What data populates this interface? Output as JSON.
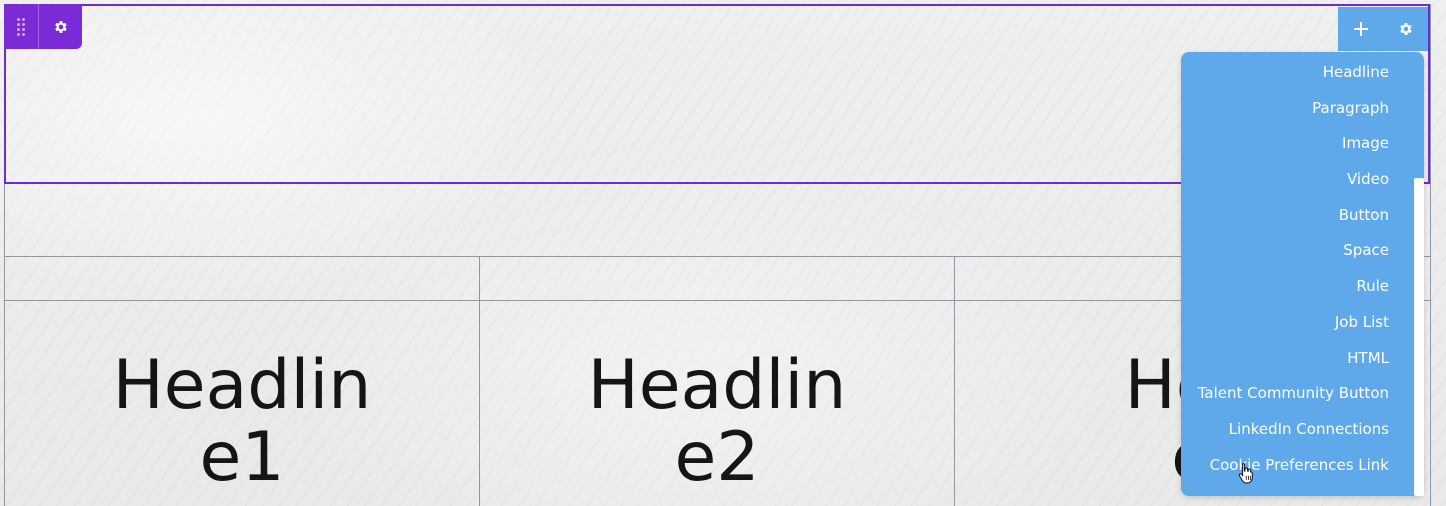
{
  "section_toolbar": {
    "drag_icon": "drag-handle-icon",
    "settings_icon": "gear-icon"
  },
  "column_toolbar": {
    "add_icon": "plus-icon",
    "settings_icon": "gear-icon"
  },
  "columns": [
    {
      "headline_line1": "Headlin",
      "headline_line2": "e1"
    },
    {
      "headline_line1": "Headlin",
      "headline_line2": "e2"
    },
    {
      "headline_line1": "Hea",
      "headline_line2": "e"
    }
  ],
  "add_menu": {
    "items": [
      "Headline",
      "Paragraph",
      "Image",
      "Video",
      "Button",
      "Space",
      "Rule",
      "Job List",
      "HTML",
      "Talent Community Button",
      "LinkedIn Connections",
      "Cookie Preferences Link"
    ]
  },
  "colors": {
    "selection_purple": "#7b2bd6",
    "toolbar_blue": "#5fa8ea",
    "grid_line": "#8e96a0",
    "headline_text": "#151515"
  }
}
